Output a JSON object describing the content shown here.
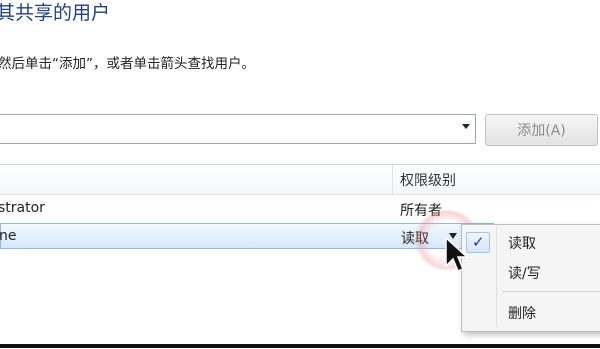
{
  "dialog": {
    "title": "其共享的用户",
    "instruction": "然后单击“添加”，或者单击箭头查找用户。",
    "add_button": "添加(A)"
  },
  "user_list": {
    "header_permission": "权限级别",
    "rows": [
      {
        "name": "strator",
        "permission": "所有者"
      },
      {
        "name": "ne",
        "permission": "读取",
        "selected": true
      }
    ]
  },
  "context_menu": {
    "items": [
      {
        "label": "读取",
        "checked": true
      },
      {
        "label": "读/写",
        "checked": false
      },
      {
        "label": "删除",
        "checked": false
      }
    ]
  },
  "icons": {
    "combo_dropdown": "dropdown-arrow-icon",
    "permission_dropdown": "dropdown-arrow-icon",
    "checkmark": "checkmark-icon",
    "cursor": "mouse-pointer-icon"
  },
  "colors": {
    "title": "#1f3f8f",
    "selection": "#d6e8fb",
    "disabled_text": "#8b8b8b"
  }
}
